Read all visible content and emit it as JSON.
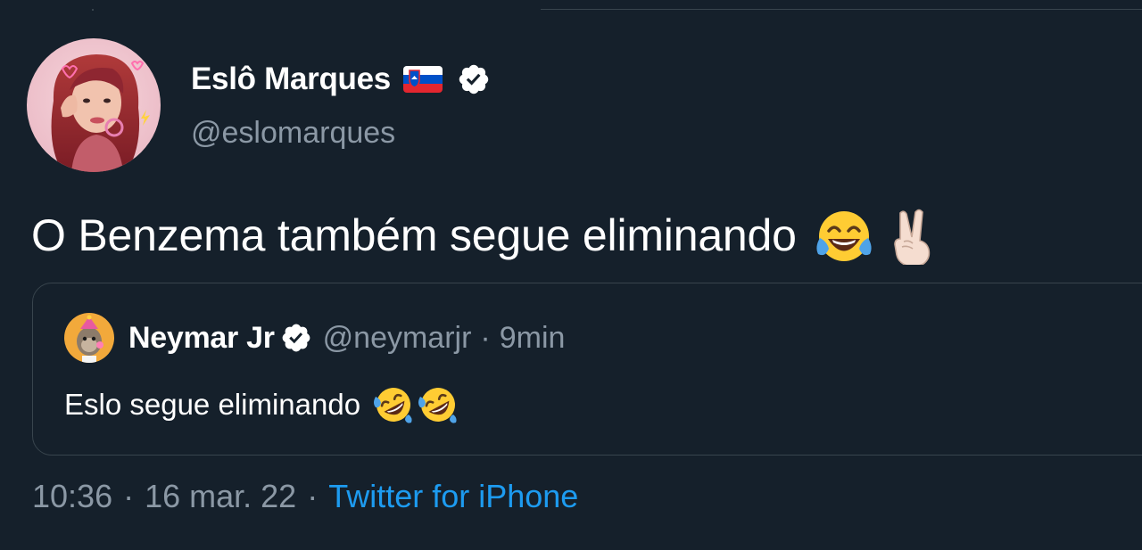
{
  "tweet": {
    "author": {
      "display_name": "Eslô Marques",
      "handle": "@eslomarques",
      "flag_icon": "slovenia-flag-icon",
      "verified_icon": "verified-badge-icon"
    },
    "text": "O Benzema também segue eliminando",
    "emojis": [
      "face-with-tears-of-joy-icon",
      "victory-hand-icon"
    ],
    "quoted": {
      "display_name": "Neymar Jr",
      "handle": "@neymarjr",
      "separator": "·",
      "time": "9min",
      "text": "Eslo segue eliminando",
      "emojis": [
        "rolling-on-floor-laughing-icon",
        "rolling-on-floor-laughing-icon"
      ]
    },
    "meta": {
      "time": "10:36",
      "separator": "·",
      "date": "16 mar. 22",
      "source": "Twitter for iPhone"
    }
  },
  "colors": {
    "background": "#15202b",
    "text_primary": "#ffffff",
    "text_secondary": "#8b98a5",
    "link": "#1d9bf0",
    "border": "#38444d"
  }
}
